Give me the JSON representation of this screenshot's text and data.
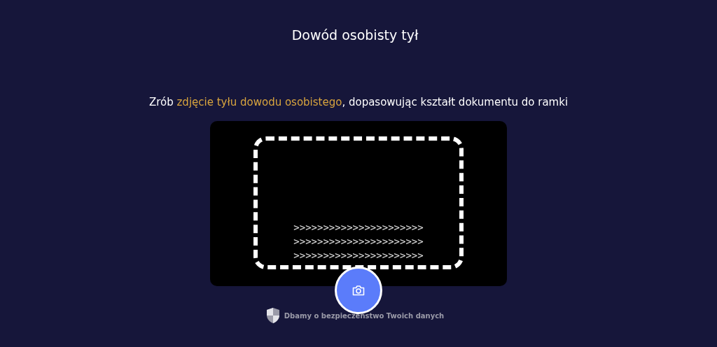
{
  "title": "Dowód osobisty tył",
  "instruction": {
    "prefix": "Zrób ",
    "highlight": "zdjęcie tyłu dowodu osobistego",
    "suffix": ", dopasowując kształt dokumentu do ramki"
  },
  "mrz_lines": [
    ">>>>>>>>>>>>>>>>>>>>>>",
    ">>>>>>>>>>>>>>>>>>>>>>",
    ">>>>>>>>>>>>>>>>>>>>>>"
  ],
  "footer": "Dbamy o bezpieczeństwo Twoich danych"
}
